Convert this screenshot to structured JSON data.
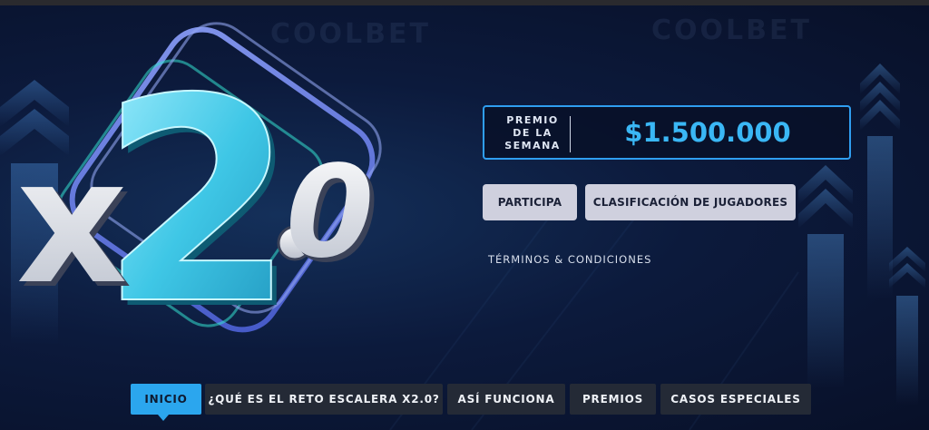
{
  "brand": {
    "watermark": "COOLBET"
  },
  "hero": {
    "logo_text": "x2.0",
    "prize_label": [
      "PREMIO",
      "DE LA",
      "SEMANA"
    ],
    "prize_amount": "$1.500.000"
  },
  "actions": {
    "participate": "PARTICIPA",
    "leaderboard": "CLASIFICACIÓN DE JUGADORES",
    "terms": "TÉRMINOS & CONDICIONES"
  },
  "nav": {
    "items": [
      {
        "label": "INICIO",
        "active": true
      },
      {
        "label": "¿QUÉ ES EL RETO ESCALERA X2.0?"
      },
      {
        "label": "ASÍ FUNCIONA"
      },
      {
        "label": "PREMIOS"
      },
      {
        "label": "CASOS ESPECIALES"
      }
    ]
  },
  "colors": {
    "accent": "#2ba6ee",
    "prize_text": "#3ab7f5",
    "background": "#0b1430"
  }
}
